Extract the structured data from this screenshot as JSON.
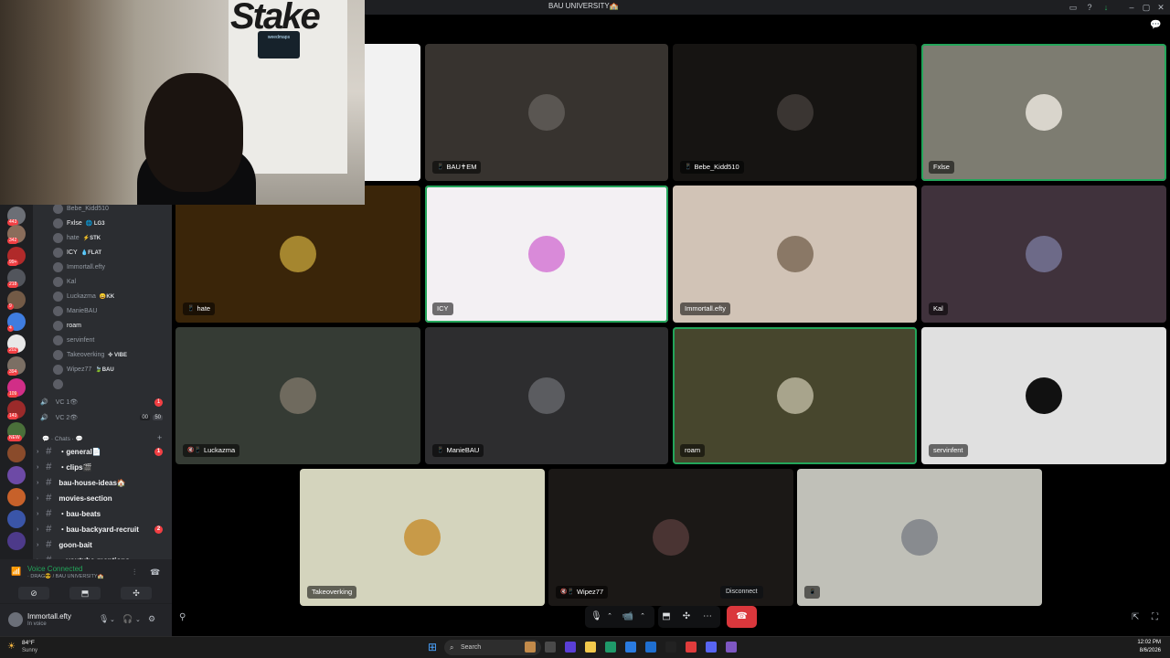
{
  "window": {
    "title": "BAU UNIVERSITY🏫"
  },
  "colors": {
    "speaking_border": "#23a55a",
    "disconnect": "#da373c",
    "mention_badge": "#f23f43",
    "voice_connected": "#23a55a"
  },
  "webcam": {
    "sign_text": "Stake",
    "neon_text": "weedmaps"
  },
  "rail": {
    "badges": [
      "443",
      "342",
      "99+",
      "218",
      "9",
      "4",
      "202",
      "394",
      "109",
      "143",
      "NEW"
    ]
  },
  "voice_members": [
    {
      "name": "Bebe_Kidd510",
      "tag": ""
    },
    {
      "name": "Fxlse",
      "tag": "🌐 LG3"
    },
    {
      "name": "hate",
      "tag": "⚡STK"
    },
    {
      "name": "ICY",
      "tag": "💧FLAT"
    },
    {
      "name": "Immortall.efty",
      "tag": ""
    },
    {
      "name": "Kal",
      "tag": ""
    },
    {
      "name": "Luckazma",
      "tag": "😄KK"
    },
    {
      "name": "ManieBAU",
      "tag": ""
    },
    {
      "name": "roam",
      "tag": ""
    },
    {
      "name": "servinfent",
      "tag": ""
    },
    {
      "name": "Takeoverking",
      "tag": "✣ VIBE"
    },
    {
      "name": "Wipez77",
      "tag": "🍃BAU"
    }
  ],
  "voice_channels": [
    {
      "name": "VC 1👁",
      "badge": "1"
    },
    {
      "name": "VC 2👁",
      "count_a": "00",
      "count_b": "50"
    }
  ],
  "category": {
    "label": "💬 · Chats · 💬"
  },
  "text_channels": [
    {
      "name": "・general📄",
      "badge": "1"
    },
    {
      "name": "・clips🎬",
      "badge": ""
    },
    {
      "name": "bau-house-ideas🏠",
      "badge": ""
    },
    {
      "name": "movies-section",
      "badge": ""
    },
    {
      "name": "・bau-beats",
      "badge": ""
    },
    {
      "name": "・bau-backyard-recruit",
      "badge": "2"
    },
    {
      "name": "goon-bait",
      "badge": ""
    },
    {
      "name": "・youtube-mentions",
      "badge": ""
    }
  ],
  "voice_status": {
    "title": "Voice Connected",
    "subtitle": "· DRAG😎 / BAU UNIVERSITY🏫"
  },
  "user": {
    "name": "Immortall.efty",
    "status": "In voice"
  },
  "tiles": [
    {
      "name": "",
      "bg": "#f2f2f2",
      "avatar": "#cfcfcf"
    },
    {
      "name": "BAU✝EM",
      "bg": "#37332f",
      "avatar": "#5a5652",
      "icon": "📱"
    },
    {
      "name": "Bebe_Kidd510",
      "bg": "#161412",
      "avatar": "#3a3532",
      "icon": "📱"
    },
    {
      "name": "Fxlse",
      "bg": "#7d7c71",
      "avatar": "#d9d5cc",
      "speaking": true
    },
    {
      "name": "hate",
      "bg": "#3a2509",
      "avatar": "#a5862f",
      "icon": "📱"
    },
    {
      "name": "ICY",
      "bg": "#f3f0f3",
      "avatar": "#d98ad9",
      "speaking": true
    },
    {
      "name": "Immortall.efty",
      "bg": "#d1c3b6",
      "avatar": "#8a7866"
    },
    {
      "name": "Kal",
      "bg": "#40323c",
      "avatar": "#6d6a88"
    },
    {
      "name": "Luckazma",
      "bg": "#353b34",
      "avatar": "#6f6a5e",
      "icon": "🔇📱"
    },
    {
      "name": "ManieBAU",
      "bg": "#2d2d2f",
      "avatar": "#5b5c60",
      "icon": "📱"
    },
    {
      "name": "roam",
      "bg": "#47462d",
      "avatar": "#a8a48c",
      "speaking": true
    },
    {
      "name": "servinfent",
      "bg": "#e0e0e0",
      "avatar": "#111111"
    },
    {
      "name": "Takeoverking",
      "bg": "#d4d4bd",
      "avatar": "#c89a48"
    },
    {
      "name": "Wipez77",
      "bg": "#1b1816",
      "avatar": "#4a3433",
      "icon": "🔇📱"
    },
    {
      "name": "",
      "bg": "#c0c0b8",
      "avatar": "#888b8f",
      "icon": "📱"
    }
  ],
  "controls": {
    "disconnect_tooltip": "Disconnect"
  },
  "taskbar": {
    "temperature": "84°F",
    "weather": "Sunny",
    "search_placeholder": "Search",
    "time": "12:02 PM",
    "date": "8/6/2026"
  }
}
